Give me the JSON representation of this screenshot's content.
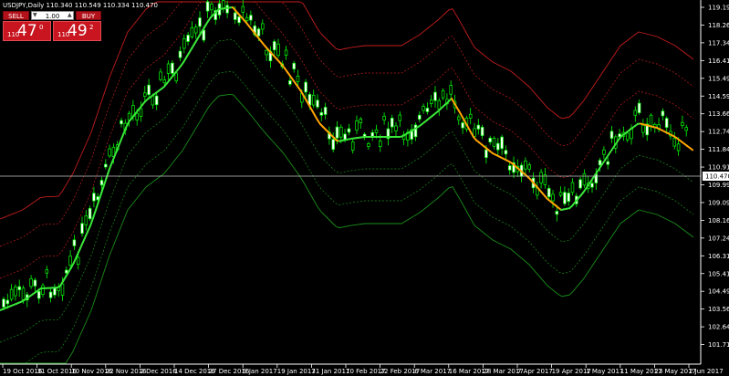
{
  "header": {
    "title": "USDJPY,Daily  110.340 110.549 110.334 110.470"
  },
  "trade_panel": {
    "sell_label": "SELL",
    "buy_label": "BUY",
    "lot_value": "1.00",
    "sell_quote": {
      "prefix": "110",
      "big": "47",
      "sup": "0"
    },
    "buy_quote": {
      "prefix": "110",
      "big": "49",
      "sup": "2"
    }
  },
  "price_axis": {
    "labels": [
      "119.190",
      "118.265",
      "117.340",
      "116.415",
      "115.490",
      "114.590",
      "113.665",
      "112.740",
      "111.840",
      "110.915",
      "110.470",
      "109.990",
      "109.090",
      "108.165",
      "107.240",
      "106.315",
      "105.415",
      "104.490",
      "103.565",
      "102.640",
      "101.715"
    ],
    "current_price": "110.470"
  },
  "time_axis": {
    "labels": [
      "19 Oct 2016",
      "31 Oct 2016",
      "10 Nov 2016",
      "22 Nov 2016",
      "2 Dec 2016",
      "14 Dec 2016",
      "27 Dec 2016",
      "9 Jan 2017",
      "19 Jan 2017",
      "31 Jan 2017",
      "10 Feb 2017",
      "22 Feb 2017",
      "6 Mar 2017",
      "16 Mar 2017",
      "28 Mar 2017",
      "7 Apr 2017",
      "19 Apr 2017",
      "1 May 2017",
      "11 May 2017",
      "23 May 2017",
      "2 Jun 2017"
    ]
  },
  "colors": {
    "background": "#000000",
    "candle": "#00ff00",
    "ma_up": "#39e639",
    "ma_down": "#ffa500",
    "band_red": "#c41d1d",
    "band_green": "#1a8f1a",
    "grid_line": "#ffffff"
  }
}
